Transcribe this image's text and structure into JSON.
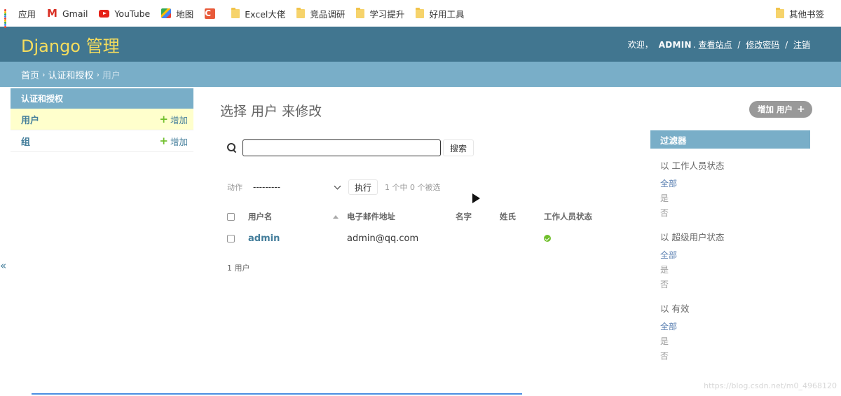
{
  "bookmarks": [
    {
      "label": "应用",
      "icon": "apps-grid-icon"
    },
    {
      "label": "Gmail",
      "icon": "gmail-icon"
    },
    {
      "label": "YouTube",
      "icon": "youtube-icon"
    },
    {
      "label": "地图",
      "icon": "maps-icon"
    },
    {
      "label": "",
      "icon": "c-app-icon"
    },
    {
      "label": "Excel大佬",
      "icon": "folder-icon"
    },
    {
      "label": "竞品调研",
      "icon": "folder-icon"
    },
    {
      "label": "学习提升",
      "icon": "folder-icon"
    },
    {
      "label": "好用工具",
      "icon": "folder-icon"
    }
  ],
  "bookmarks_other": "其他书签",
  "gmail_glyph": "M",
  "c_glyph": "C",
  "header": {
    "brand": "Django 管理",
    "welcome": "欢迎，",
    "username": "ADMIN",
    "view_site": "查看站点",
    "change_password": "修改密码",
    "logout": "注销",
    "sep": "/"
  },
  "breadcrumbs": {
    "home": "首页",
    "app": "认证和授权",
    "current": "用户",
    "arrow": "›"
  },
  "sidebar": {
    "caption": "认证和授权",
    "items": [
      {
        "label": "用户",
        "add": "增加"
      },
      {
        "label": "组",
        "add": "增加"
      }
    ],
    "toggle": "«"
  },
  "content": {
    "title": "选择 用户 来修改",
    "add_button": "增加 用户",
    "search_value": "",
    "search_button": "搜索",
    "action_label": "动作",
    "action_selected": "---------",
    "go_button": "执行",
    "counter": "1 个中 0 个被选",
    "columns": [
      "用户名",
      "电子邮件地址",
      "名字",
      "姓氏",
      "工作人员状态"
    ],
    "rows": [
      {
        "username": "admin",
        "email": "admin@qq.com",
        "first_name": "",
        "last_name": "",
        "is_staff": true
      }
    ],
    "paginator": "1 用户"
  },
  "filter": {
    "title": "过滤器",
    "groups": [
      {
        "title": "以 工作人员状态",
        "options": [
          "全部",
          "是",
          "否"
        ]
      },
      {
        "title": "以 超级用户状态",
        "options": [
          "全部",
          "是",
          "否"
        ]
      },
      {
        "title": "以 有效",
        "options": [
          "全部",
          "是",
          "否"
        ]
      }
    ]
  },
  "watermark": "https://blog.csdn.net/m0_4968120",
  "colors": {
    "header_bg": "#417690",
    "brand": "#f5dd5d",
    "breadcrumbs_bg": "#79aec8",
    "link": "#447e9b",
    "add_green": "#70bf2b",
    "current_row": "#ffffcc"
  }
}
